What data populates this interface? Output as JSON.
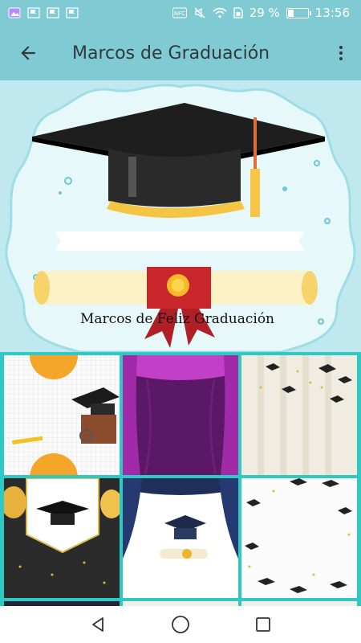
{
  "status_bar": {
    "battery_text": "29 %",
    "time": "13:56",
    "battery_level": 0.29,
    "left_icons": [
      "gallery-icon",
      "flag-icon",
      "flag-icon",
      "flag-icon"
    ],
    "right_icons": [
      "nfc-icon",
      "mute-icon",
      "wifi-icon",
      "sim-icon",
      "battery-icon"
    ]
  },
  "app_bar": {
    "title": "Marcos de Graduación",
    "back_icon": "arrow-left-icon",
    "menu_icon": "more-vert-icon",
    "color": "#80cbd3"
  },
  "banner": {
    "ribbon_text": "Marcos de Feliz Graduación"
  },
  "grid": {
    "border_color": "#2ec9c3",
    "tiles": [
      {
        "name": "frame-notebook-orange"
      },
      {
        "name": "frame-purple-curtain"
      },
      {
        "name": "frame-caps-striped"
      },
      {
        "name": "frame-gold-balloons"
      },
      {
        "name": "frame-blue-curtain-diploma"
      },
      {
        "name": "frame-caps-confetti"
      }
    ]
  },
  "nav_bar": {
    "icons": [
      "back-triangle-icon",
      "home-circle-icon",
      "recents-square-icon"
    ]
  }
}
